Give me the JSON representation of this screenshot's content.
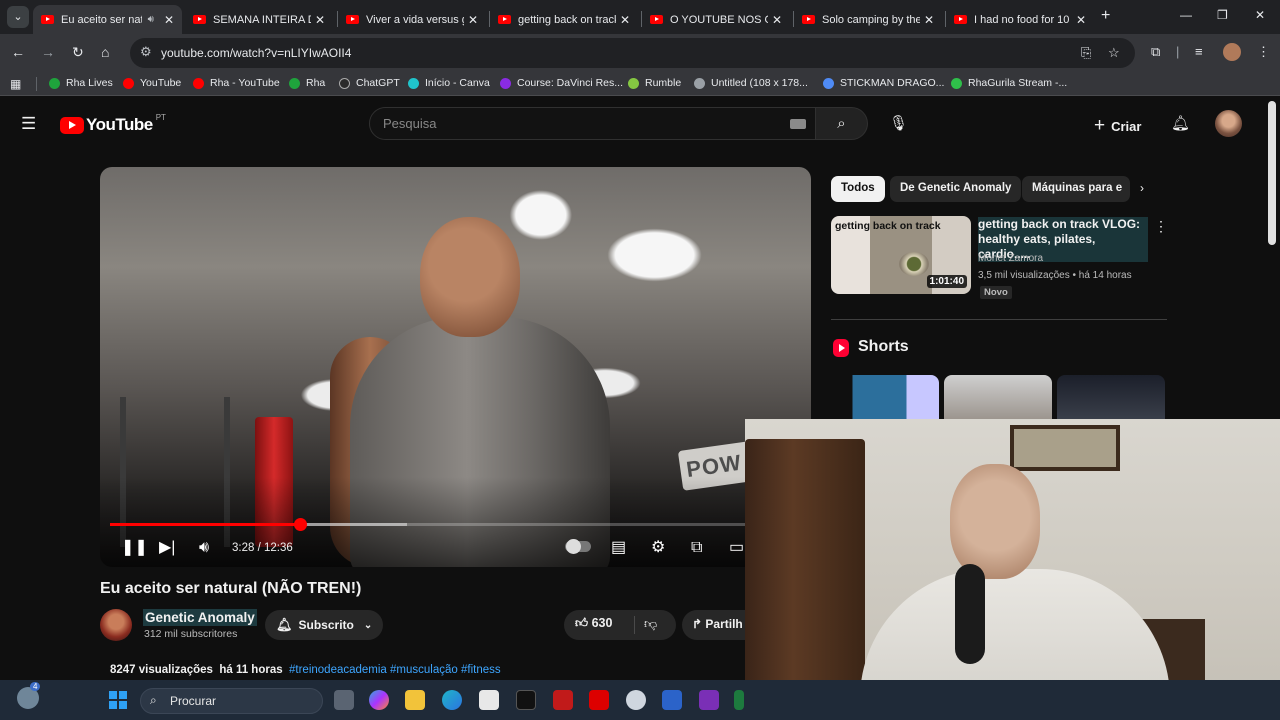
{
  "browser": {
    "tabs": [
      {
        "title": "Eu aceito ser nat",
        "active": true,
        "audio": true
      },
      {
        "title": "SEMANA INTEIRA DE",
        "active": false
      },
      {
        "title": "Viver a vida versus g",
        "active": false
      },
      {
        "title": "getting back on track",
        "active": false
      },
      {
        "title": "O YOUTUBE NOS OD",
        "active": false
      },
      {
        "title": "Solo camping by the",
        "active": false
      },
      {
        "title": "I had no food for 10",
        "active": false
      }
    ],
    "url": "youtube.com/watch?v=nLIYIwAOII4",
    "bookmarks": [
      {
        "label": "Rha Lives",
        "color": "#1fa33c"
      },
      {
        "label": "YouTube",
        "color": "#ff0000"
      },
      {
        "label": "Rha - YouTube",
        "color": "#ff0000"
      },
      {
        "label": "Rha",
        "color": "#1fa33c"
      },
      {
        "label": "ChatGPT",
        "color": "#2b2b2b"
      },
      {
        "label": "Início - Canva",
        "color": "#20c4cb"
      },
      {
        "label": "Course: DaVinci Res...",
        "color": "#8a2be2"
      },
      {
        "label": "Rumble",
        "color": "#85c742"
      },
      {
        "label": "Untitled (108 x 178...",
        "color": "#9aa0a6"
      },
      {
        "label": "STICKMAN DRAGO...",
        "color": "#4f8bf5"
      },
      {
        "label": "RhaGurila Stream -...",
        "color": "#2fbf4a"
      }
    ]
  },
  "youtube": {
    "logo_text": "YouTube",
    "region": "PT",
    "search_placeholder": "Pesquisa",
    "create_label": "Criar",
    "player": {
      "time_current": "3:28",
      "time_total": "12:36",
      "progress_fraction": 0.275,
      "buffered_fraction": 0.43,
      "sign_text": "POW"
    },
    "video": {
      "title": "Eu aceito ser natural (NÃO TREN!)",
      "channel": "Genetic Anomaly",
      "subscribers": "312 mil subscritores",
      "subscribe_label": "Subscrito",
      "likes": "630",
      "share_label": "Partilh",
      "views": "8247 visualizações",
      "age": "há 11 horas",
      "hashtags": "#treinodeacademia #musculação #fitness"
    },
    "chips": [
      {
        "label": "Todos",
        "selected": true
      },
      {
        "label": "De Genetic Anomaly",
        "selected": false
      },
      {
        "label": "Máquinas para e",
        "selected": false
      }
    ],
    "recommendation": {
      "thumb_text": "getting back on track",
      "duration": "1:01:40",
      "title": "getting back on track VLOG: healthy eats, pilates, cardio.....",
      "channel": "Monet Zamora",
      "meta": "3,5 mil visualizações • há 14 horas",
      "badge": "Novo"
    },
    "shorts_label": "Shorts"
  },
  "taskbar": {
    "search_label": "Procurar",
    "weather_badge": "4"
  }
}
